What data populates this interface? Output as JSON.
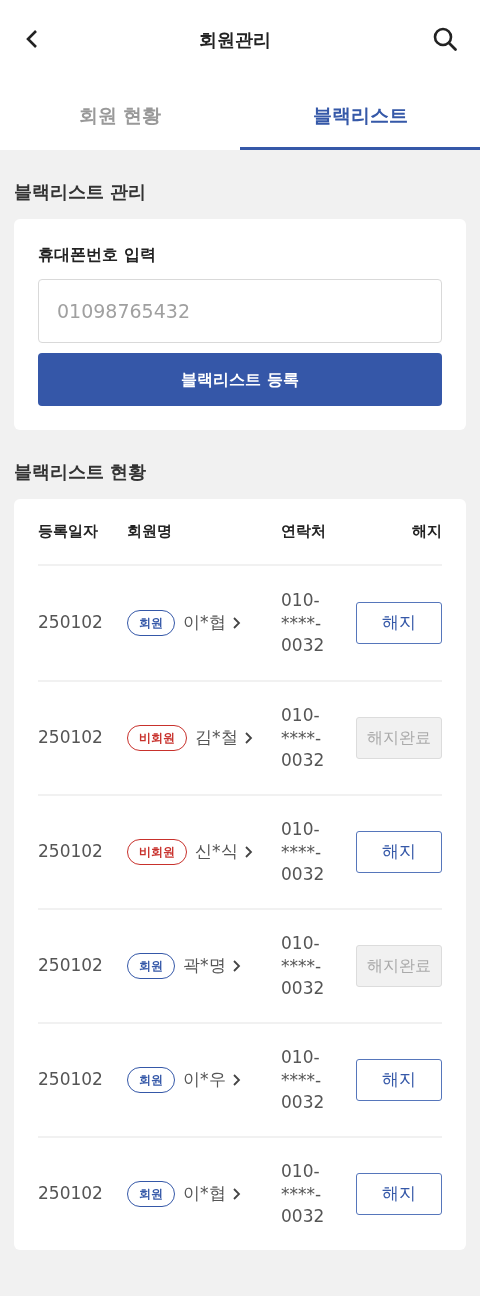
{
  "header": {
    "title": "회원관리"
  },
  "tabs": [
    {
      "label": "회원 현황",
      "selected": false
    },
    {
      "label": "블랙리스트",
      "selected": true
    }
  ],
  "register": {
    "section_title": "블랙리스트 관리",
    "field_label": "휴대폰번호 입력",
    "placeholder": "01098765432",
    "button": "블랙리스트 등록"
  },
  "list": {
    "section_title": "블랙리스트 현황",
    "columns": [
      "등록일자",
      "회원명",
      "연락처",
      "해지"
    ],
    "rows": [
      {
        "date": "250102",
        "badge": "회원",
        "kind": "member",
        "name": "이*협",
        "phone": "010-****-0032",
        "action": "해지",
        "disabled": false
      },
      {
        "date": "250102",
        "badge": "비회원",
        "kind": "nonmember",
        "name": "김*철",
        "phone": "010-****-0032",
        "action": "해지완료",
        "disabled": true
      },
      {
        "date": "250102",
        "badge": "비회원",
        "kind": "nonmember",
        "name": "신*식",
        "phone": "010-****-0032",
        "action": "해지",
        "disabled": false
      },
      {
        "date": "250102",
        "badge": "회원",
        "kind": "member",
        "name": "곽*명",
        "phone": "010-****-0032",
        "action": "해지완료",
        "disabled": true
      },
      {
        "date": "250102",
        "badge": "회원",
        "kind": "member",
        "name": "이*우",
        "phone": "010-****-0032",
        "action": "해지",
        "disabled": false
      },
      {
        "date": "250102",
        "badge": "회원",
        "kind": "member",
        "name": "이*협",
        "phone": "010-****-0032",
        "action": "해지",
        "disabled": false
      }
    ]
  }
}
